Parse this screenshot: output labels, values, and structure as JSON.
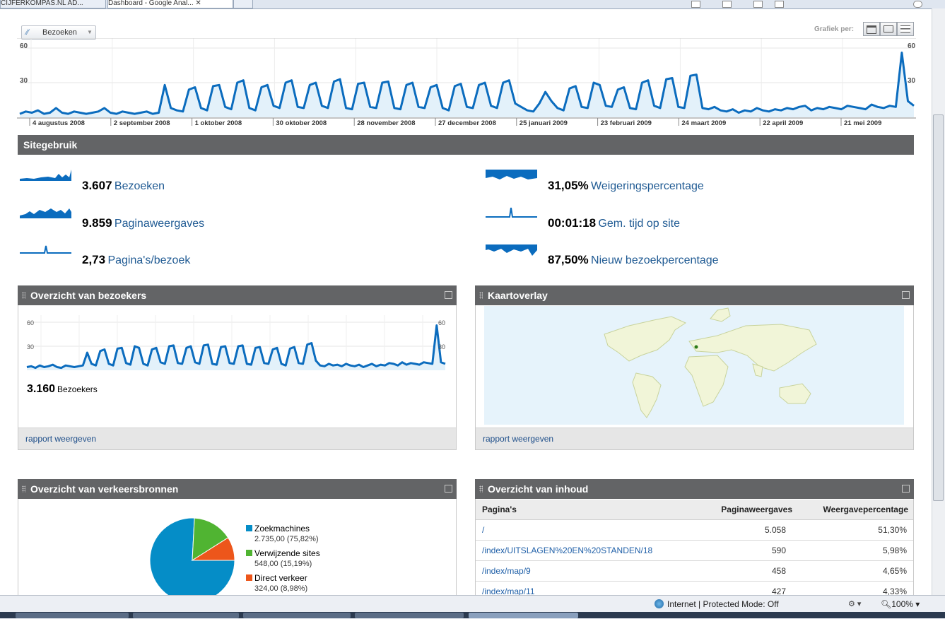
{
  "browser": {
    "tabs": [
      "CIJFERKOMPAS.NL AD...",
      "Dashboard - Google Anal..."
    ],
    "status_zone": "Internet | Protected Mode: Off",
    "zoom": "100%"
  },
  "colors": {
    "accent": "#0b6cbe",
    "header_bg": "#636466",
    "link": "#1f5a93"
  },
  "main_chart": {
    "selector_label": "Bezoeken",
    "grafiek_label": "Grafiek per:",
    "view_buttons": [
      "dag",
      "week",
      "maand"
    ],
    "y_labels": {
      "max": "60",
      "mid": "30"
    },
    "x_labels": [
      "4 augustus 2008",
      "2 september 2008",
      "1 oktober 2008",
      "30 oktober 2008",
      "28 november 2008",
      "27 december 2008",
      "25 januari 2009",
      "23 februari 2009",
      "24 maart 2009",
      "22 april 2009",
      "21 mei 2009"
    ]
  },
  "chart_data": [
    {
      "type": "area",
      "title": "",
      "ylabel": "Bezoeken",
      "ylim": [
        0,
        60
      ],
      "x_ticks": [
        "4 augustus 2008",
        "2 september 2008",
        "1 oktober 2008",
        "30 oktober 2008",
        "28 november 2008",
        "27 december 2008",
        "25 januari 2009",
        "23 februari 2009",
        "24 maart 2009",
        "22 april 2009",
        "21 mei 2009"
      ],
      "series": [
        {
          "name": "Bezoeken",
          "values": [
            3,
            5,
            4,
            6,
            3,
            4,
            8,
            4,
            3,
            5,
            4,
            3,
            4,
            5,
            8,
            4,
            3,
            5,
            4,
            3,
            4,
            5,
            3,
            4,
            28,
            8,
            6,
            5,
            24,
            26,
            8,
            6,
            27,
            28,
            9,
            7,
            30,
            32,
            8,
            6,
            26,
            28,
            10,
            8,
            30,
            32,
            9,
            8,
            28,
            30,
            10,
            8,
            31,
            33,
            8,
            7,
            29,
            30,
            9,
            8,
            30,
            31,
            8,
            7,
            28,
            30,
            9,
            8,
            26,
            28,
            8,
            6,
            27,
            29,
            9,
            8,
            28,
            30,
            10,
            8,
            30,
            32,
            12,
            9,
            6,
            5,
            12,
            22,
            14,
            8,
            6,
            25,
            27,
            9,
            8,
            30,
            28,
            10,
            9,
            24,
            26,
            8,
            7,
            30,
            32,
            10,
            8,
            33,
            34,
            9,
            8,
            36,
            37,
            8,
            7,
            9,
            6,
            5,
            7,
            4,
            6,
            5,
            8,
            6,
            5,
            7,
            6,
            8,
            7,
            9,
            10,
            6,
            8,
            7,
            9,
            8,
            7,
            10,
            9,
            8,
            7,
            11,
            9,
            8,
            10,
            9,
            56,
            14,
            10
          ]
        }
      ]
    },
    {
      "type": "area",
      "title": "Overzicht van bezoekers",
      "ylim": [
        0,
        60
      ],
      "series": [
        {
          "name": "Bezoekers",
          "values": [
            4,
            5,
            3,
            6,
            4,
            5,
            7,
            4,
            3,
            6,
            5,
            4,
            5,
            6,
            22,
            8,
            6,
            24,
            26,
            8,
            6,
            27,
            28,
            9,
            7,
            30,
            28,
            8,
            6,
            26,
            28,
            10,
            8,
            30,
            31,
            9,
            8,
            28,
            30,
            10,
            8,
            31,
            32,
            8,
            7,
            29,
            30,
            9,
            8,
            30,
            31,
            8,
            7,
            28,
            29,
            9,
            8,
            26,
            28,
            8,
            6,
            27,
            29,
            9,
            8,
            32,
            34,
            12,
            6,
            5,
            8,
            6,
            7,
            5,
            8,
            6,
            5,
            7,
            4,
            6,
            8,
            5,
            7,
            6,
            9,
            8,
            6,
            10,
            7,
            9,
            8,
            7,
            10,
            9,
            8,
            56,
            10,
            8
          ]
        }
      ]
    },
    {
      "type": "pie",
      "title": "Overzicht van verkeersbronnen",
      "categories": [
        "Zoekmachines",
        "Verwijzende sites",
        "Direct verkeer"
      ],
      "values": [
        2735,
        548,
        324
      ],
      "colors": [
        "#058dc7",
        "#50b432",
        "#ed561b"
      ]
    }
  ],
  "site_usage": {
    "title": "Sitegebruik",
    "metrics": [
      {
        "value": "3.607",
        "label": "Bezoeken"
      },
      {
        "value": "9.859",
        "label": "Paginaweergaves"
      },
      {
        "value": "2,73",
        "label": "Pagina's/bezoek"
      },
      {
        "value": "31,05%",
        "label": "Weigeringspercentage"
      },
      {
        "value": "00:01:18",
        "label": "Gem. tijd op site"
      },
      {
        "value": "87,50%",
        "label": "Nieuw bezoekpercentage"
      }
    ]
  },
  "visitors_panel": {
    "title": "Overzicht van bezoekers",
    "y_max": "60",
    "y_mid": "30",
    "count": "3.160",
    "count_label": "Bezoekers",
    "footer_link": "rapport weergeven"
  },
  "map_panel": {
    "title": "Kaartoverlay",
    "footer_link": "rapport weergeven"
  },
  "traffic_panel": {
    "title": "Overzicht van verkeersbronnen",
    "legend": [
      {
        "name": "Zoekmachines",
        "detail": "2.735,00 (75,82%)"
      },
      {
        "name": "Verwijzende sites",
        "detail": "548,00 (15,19%)"
      },
      {
        "name": "Direct verkeer",
        "detail": "324,00 (8,98%)"
      }
    ]
  },
  "content_panel": {
    "title": "Overzicht van inhoud",
    "headers": [
      "Pagina's",
      "Paginaweergaves",
      "Weergavepercentage"
    ],
    "rows": [
      {
        "page": "/",
        "views": "5.058",
        "pct": "51,30%"
      },
      {
        "page": "/index/UITSLAGEN%20EN%20STANDEN/18",
        "views": "590",
        "pct": "5,98%"
      },
      {
        "page": "/index/map/9",
        "views": "458",
        "pct": "4,65%"
      },
      {
        "page": "/index/map/11",
        "views": "427",
        "pct": "4,33%"
      }
    ]
  }
}
